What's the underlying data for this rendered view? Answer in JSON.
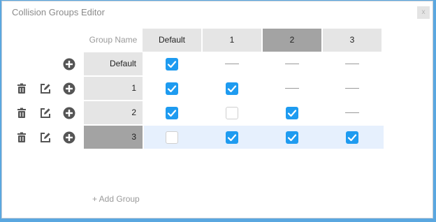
{
  "window": {
    "title": "Collision Groups Editor",
    "close_glyph": "x"
  },
  "table": {
    "name_header": "Group Name",
    "columns": [
      "Default",
      "1",
      "2",
      "3"
    ],
    "selected_column": 2,
    "rows": [
      {
        "name": "Default",
        "deletable": false,
        "editable": false,
        "cells": [
          "checked",
          "none",
          "none",
          "none"
        ]
      },
      {
        "name": "1",
        "deletable": true,
        "editable": true,
        "cells": [
          "checked",
          "checked",
          "none",
          "none"
        ]
      },
      {
        "name": "2",
        "deletable": true,
        "editable": true,
        "cells": [
          "checked",
          "unchecked",
          "checked",
          "none"
        ]
      },
      {
        "name": "3",
        "deletable": true,
        "editable": true,
        "cells": [
          "unchecked",
          "checked",
          "checked",
          "checked"
        ]
      }
    ],
    "selected_row": 3
  },
  "add_group_label": "+ Add Group",
  "colors": {
    "checkbox_checked": "#1e9bf0",
    "selected_header": "#a3a3a3",
    "header_bg": "#e5e5e5",
    "selected_row_bg": "#e6f0fd",
    "icon": "#555555"
  },
  "icons": {
    "delete": "trash-icon",
    "edit": "edit-icon",
    "add": "plus-circle-icon"
  }
}
